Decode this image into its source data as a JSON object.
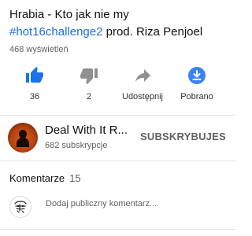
{
  "video": {
    "title_part1": "Hrabia - Kto jak nie my",
    "title_hashtag": "#hot16challenge2",
    "title_part2": " prod. Riza Penjoel",
    "views": "468 wyświetleń"
  },
  "actions": {
    "like": {
      "count": "36",
      "icon": "thumbs-up-icon",
      "color": "#1a73e8"
    },
    "dislike": {
      "count": "2",
      "icon": "thumbs-down-icon"
    },
    "share": {
      "label": "Udostępnij",
      "icon": "share-arrow-icon"
    },
    "download": {
      "label": "Pobrano",
      "icon": "download-complete-icon",
      "color": "#3b82f6"
    }
  },
  "channel": {
    "name": "Deal With It R...",
    "subscribers": "682 subskrypcje",
    "subscribe_label": "SUBSKRYBUJES"
  },
  "comments": {
    "label": "Komentarze",
    "count": "15",
    "placeholder": "Dodaj publiczny komentarz..."
  },
  "colors": {
    "hashtag": "#1a6fd6",
    "secondary_text": "#606060"
  }
}
